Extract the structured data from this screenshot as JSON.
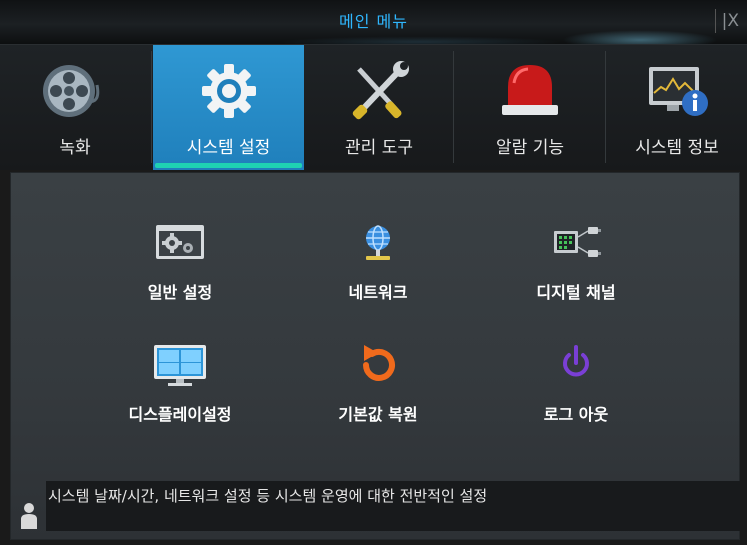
{
  "window": {
    "title": "메인 메뉴",
    "close_label": "|X"
  },
  "tabs": [
    {
      "label": "녹화",
      "icon": "film-reel-icon",
      "active": false
    },
    {
      "label": "시스템 설정",
      "icon": "gear-icon",
      "active": true
    },
    {
      "label": "관리 도구",
      "icon": "tools-icon",
      "active": false
    },
    {
      "label": "알람 기능",
      "icon": "alarm-light-icon",
      "active": false
    },
    {
      "label": "시스템 정보",
      "icon": "system-info-icon",
      "active": false
    }
  ],
  "menu_items": [
    {
      "label": "일반 설정",
      "icon": "general-settings-icon"
    },
    {
      "label": "네트워크",
      "icon": "network-globe-icon"
    },
    {
      "label": "디지털 채널",
      "icon": "digital-channel-icon"
    },
    {
      "label": "디스플레이설정",
      "icon": "display-monitor-icon"
    },
    {
      "label": "기본값 복원",
      "icon": "restore-default-icon"
    },
    {
      "label": "로그 아웃",
      "icon": "power-logout-icon"
    }
  ],
  "status": {
    "text": "시스템 날짜/시간, 네트워크 설정 등 시스템 운영에 대한 전반적인 설정",
    "icon": "user-icon"
  },
  "colors": {
    "accent": "#2f98d3",
    "title": "#2fb7ff",
    "underline": "#1fd2b2",
    "panel": "#3a4044",
    "logout": "#7a3fd6",
    "restore": "#f06a1c"
  }
}
